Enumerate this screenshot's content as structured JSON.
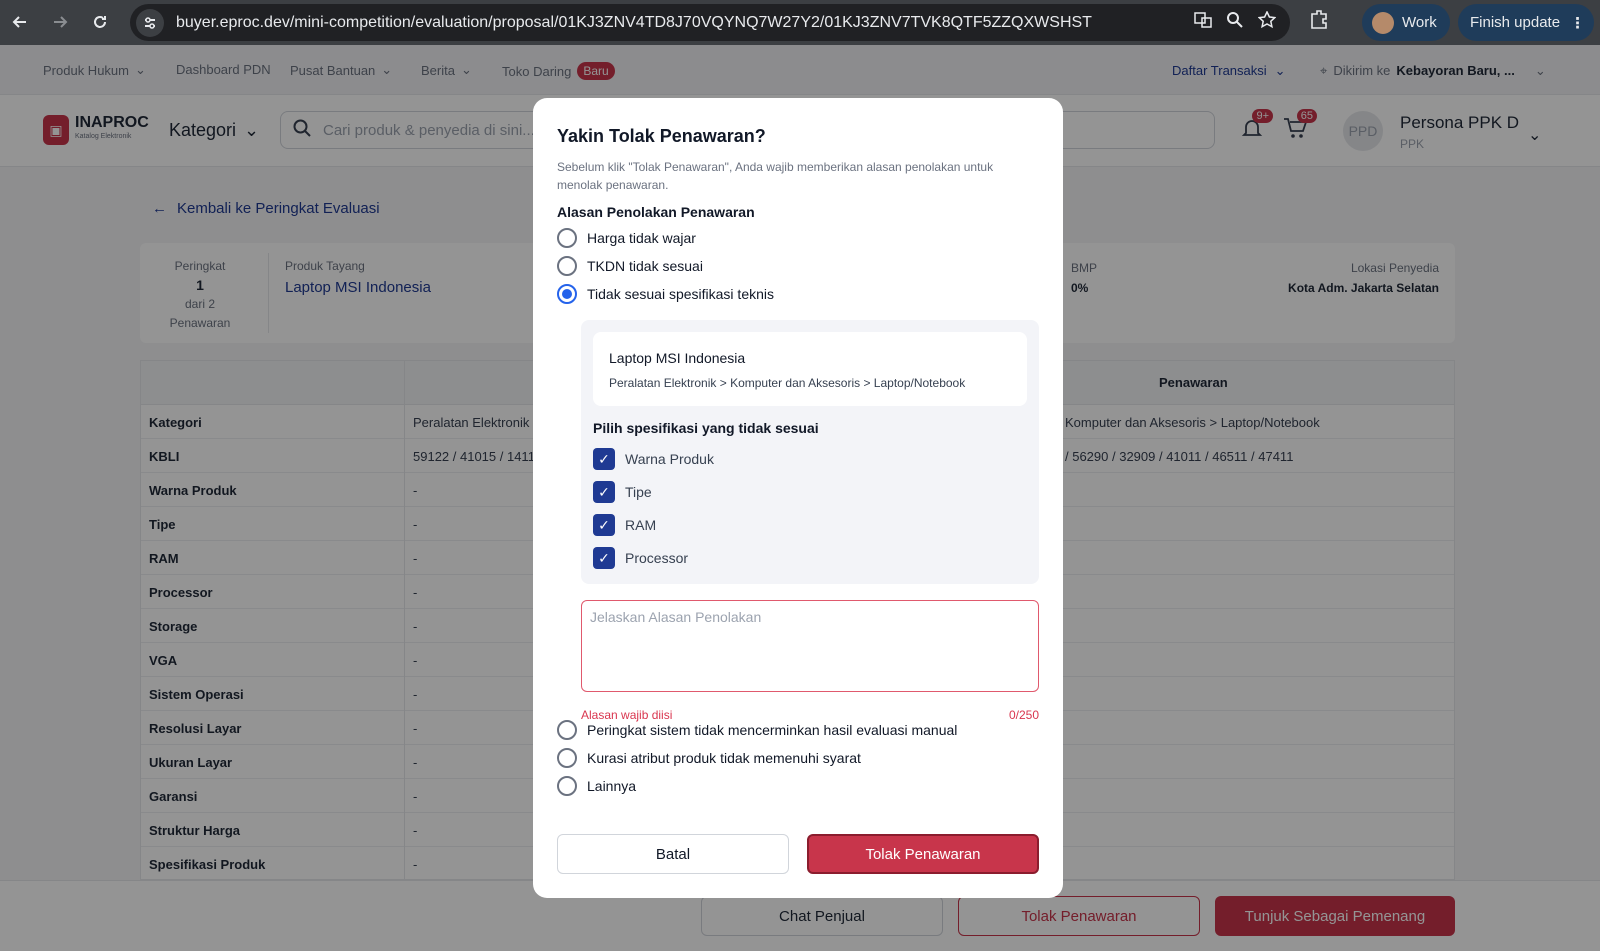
{
  "browser": {
    "url": "buyer.eproc.dev/mini-competition/evaluation/proposal/01KJ3ZNV4TD8J70VQYNQ7W27Y2/01KJ3ZNV7TVK8QTF5ZZQXWSHST",
    "profile_label": "Work",
    "update_label": "Finish update"
  },
  "topbar": {
    "links": [
      "Produk Hukum",
      "Dashboard PDN",
      "Pusat Bantuan",
      "Berita",
      "Toko Daring"
    ],
    "new_badge": "Baru",
    "transactions": "Daftar Transaksi",
    "ship_to_label": "Dikirim ke",
    "ship_to_value": "Kebayoran Baru, ..."
  },
  "header": {
    "logo_name": "INAPROC",
    "logo_sub": "Katalog Elektronik",
    "kategori": "Kategori",
    "search_placeholder": "Cari produk & penyedia di sini...",
    "notif_count": "9+",
    "cart_count": "65",
    "avatar_initials": "PPD",
    "user_name": "Persona PPK D",
    "user_role": "PPK"
  },
  "page": {
    "back_link": "Kembali ke Peringkat Evaluasi",
    "rank_label": "Peringkat",
    "rank_value": "1",
    "rank_of": "dari 2",
    "rank_unit": "Penawaran",
    "product_label": "Produk Tayang",
    "product_name": "Laptop MSI Indonesia",
    "bmp_label": "BMP",
    "bmp_value": "0%",
    "location_label": "Lokasi Penyedia",
    "location_value": "Kota Adm. Jakarta Selatan",
    "table_header_offer": "Penawaran",
    "rows": [
      {
        "label": "Kategori",
        "left": "Peralatan Elektronik >",
        "right": "Komputer dan Aksesoris > Laptop/Notebook"
      },
      {
        "label": "KBLI",
        "left": "59122 / 41015 / 14111",
        "right": "/ 56290 / 32909 / 41011 / 46511 / 47411"
      },
      {
        "label": "Warna Produk",
        "left": "-",
        "right": ""
      },
      {
        "label": "Tipe",
        "left": "-",
        "right": ""
      },
      {
        "label": "RAM",
        "left": "-",
        "right": ""
      },
      {
        "label": "Processor",
        "left": "-",
        "right": ""
      },
      {
        "label": "Storage",
        "left": "-",
        "right": ""
      },
      {
        "label": "VGA",
        "left": "-",
        "right": ""
      },
      {
        "label": "Sistem Operasi",
        "left": "-",
        "right": ""
      },
      {
        "label": "Resolusi Layar",
        "left": "-",
        "right": ""
      },
      {
        "label": "Ukuran Layar",
        "left": "-",
        "right": ""
      },
      {
        "label": "Garansi",
        "left": "-",
        "right": ""
      },
      {
        "label": "Struktur Harga",
        "left": "-",
        "right": ""
      },
      {
        "label": "Spesifikasi Produk",
        "left": "-",
        "right": ""
      }
    ],
    "footer": {
      "chat": "Chat Penjual",
      "reject": "Tolak Penawaran",
      "winner": "Tunjuk Sebagai Pemenang"
    }
  },
  "modal": {
    "title": "Yakin Tolak Penawaran?",
    "description": "Sebelum klik \"Tolak Penawaran\", Anda wajib memberikan alasan penolakan untuk menolak penawaran.",
    "reasons_label": "Alasan Penolakan Penawaran",
    "options": [
      {
        "label": "Harga tidak wajar",
        "selected": false
      },
      {
        "label": "TKDN tidak sesuai",
        "selected": false
      },
      {
        "label": "Tidak sesuai spesifikasi teknis",
        "selected": true
      },
      {
        "label": "Peringkat sistem tidak mencerminkan hasil evaluasi manual",
        "selected": false
      },
      {
        "label": "Kurasi atribut produk tidak memenuhi syarat",
        "selected": false
      },
      {
        "label": "Lainnya",
        "selected": false
      }
    ],
    "spec": {
      "product_name": "Laptop MSI Indonesia",
      "product_path": "Peralatan Elektronik > Komputer dan Aksesoris > Laptop/Notebook",
      "pick_label": "Pilih spesifikasi yang tidak sesuai",
      "items": [
        {
          "label": "Warna Produk",
          "checked": true
        },
        {
          "label": "Tipe",
          "checked": true
        },
        {
          "label": "RAM",
          "checked": true
        },
        {
          "label": "Processor",
          "checked": true
        }
      ]
    },
    "reason_placeholder": "Jelaskan Alasan Penolakan",
    "reason_value": "",
    "error_text": "Alasan wajib diisi",
    "char_count": "0/250",
    "cancel_label": "Batal",
    "confirm_label": "Tolak Penawaran"
  }
}
